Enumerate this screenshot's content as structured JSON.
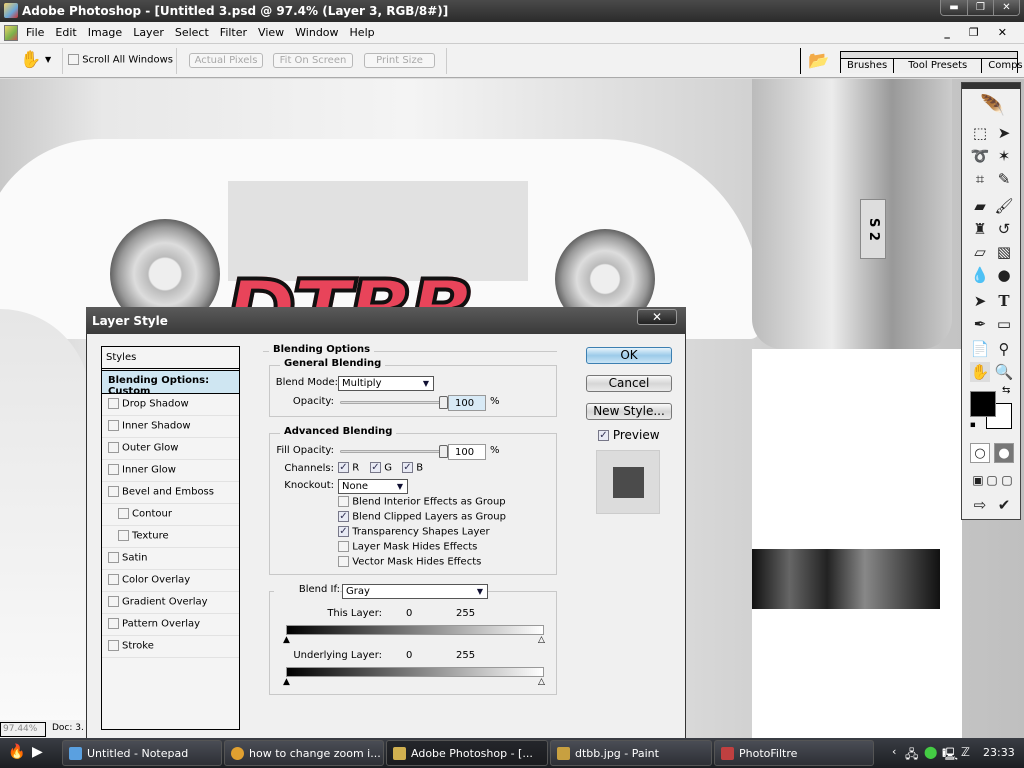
{
  "window": {
    "title": "Adobe Photoshop - [Untitled 3.psd @ 97.4% (Layer 3, RGB/8#)]",
    "controls": [
      "minimize",
      "restore",
      "close"
    ]
  },
  "menu": [
    "File",
    "Edit",
    "Image",
    "Layer",
    "Select",
    "Filter",
    "View",
    "Window",
    "Help"
  ],
  "options_bar": {
    "tool": "hand-icon",
    "scroll_all_windows": {
      "label": "Scroll All Windows",
      "checked": false
    },
    "buttons": [
      "Actual Pixels",
      "Fit On Screen",
      "Print Size"
    ],
    "palette_tabs": [
      "Brushes",
      "Tool Presets",
      "Comps"
    ]
  },
  "canvas": {
    "logo_text": "DTBB",
    "plate_text": "S 2"
  },
  "status": {
    "zoom": "97.44%",
    "doc": "Doc: 3."
  },
  "toolbox": {
    "tools": [
      "marquee",
      "move",
      "lasso",
      "magic-wand",
      "crop",
      "slice",
      "healing-brush",
      "brush",
      "clone-stamp",
      "history-brush",
      "eraser",
      "gradient",
      "blur",
      "dodge",
      "path-selection",
      "type",
      "pen",
      "shape",
      "notes",
      "eyedropper",
      "hand",
      "zoom"
    ],
    "foreground_color": "#000000",
    "background_color": "#ffffff"
  },
  "dialog": {
    "title": "Layer Style",
    "styles_header": "Styles",
    "styles": [
      {
        "label": "Blending Options: Custom",
        "selected": true
      },
      {
        "label": "Drop Shadow",
        "checked": false
      },
      {
        "label": "Inner Shadow",
        "checked": false
      },
      {
        "label": "Outer Glow",
        "checked": false
      },
      {
        "label": "Inner Glow",
        "checked": false
      },
      {
        "label": "Bevel and Emboss",
        "checked": false
      },
      {
        "label": "Contour",
        "checked": false,
        "sub": true
      },
      {
        "label": "Texture",
        "checked": false,
        "sub": true
      },
      {
        "label": "Satin",
        "checked": false
      },
      {
        "label": "Color Overlay",
        "checked": false
      },
      {
        "label": "Gradient Overlay",
        "checked": false
      },
      {
        "label": "Pattern Overlay",
        "checked": false
      },
      {
        "label": "Stroke",
        "checked": false
      }
    ],
    "blending": {
      "title": "Blending Options",
      "general_title": "General Blending",
      "blend_mode_label": "Blend Mode:",
      "blend_mode": "Multiply",
      "opacity_label": "Opacity:",
      "opacity": "100",
      "opacity_unit": "%",
      "advanced_title": "Advanced Blending",
      "fill_label": "Fill Opacity:",
      "fill": "100",
      "fill_unit": "%",
      "channels_label": "Channels:",
      "channels": [
        {
          "label": "R",
          "checked": true
        },
        {
          "label": "G",
          "checked": true
        },
        {
          "label": "B",
          "checked": true
        }
      ],
      "knockout_label": "Knockout:",
      "knockout": "None",
      "options": [
        {
          "label": "Blend Interior Effects as Group",
          "checked": false
        },
        {
          "label": "Blend Clipped Layers as Group",
          "checked": true
        },
        {
          "label": "Transparency Shapes Layer",
          "checked": true
        },
        {
          "label": "Layer Mask Hides Effects",
          "checked": false
        },
        {
          "label": "Vector Mask Hides Effects",
          "checked": false
        }
      ],
      "blend_if_label": "Blend If:",
      "blend_if": "Gray",
      "this_layer_label": "This Layer:",
      "this_layer_min": "0",
      "this_layer_max": "255",
      "underlying_label": "Underlying Layer:",
      "underlying_min": "0",
      "underlying_max": "255"
    },
    "buttons": {
      "ok": "OK",
      "cancel": "Cancel",
      "new_style": "New Style..."
    },
    "preview": {
      "label": "Preview",
      "checked": true
    }
  },
  "taskbar": {
    "tasks": [
      {
        "label": "Untitled - Notepad",
        "color": "#5aa0e0"
      },
      {
        "label": "how to change zoom i...",
        "color": "#e0a030"
      },
      {
        "label": "Adobe Photoshop - [...",
        "color": "#d0b050",
        "active": true
      },
      {
        "label": "dtbb.jpg - Paint",
        "color": "#c8a040"
      },
      {
        "label": "PhotoFiltre",
        "color": "#c04040"
      }
    ],
    "clock": "23:33"
  }
}
